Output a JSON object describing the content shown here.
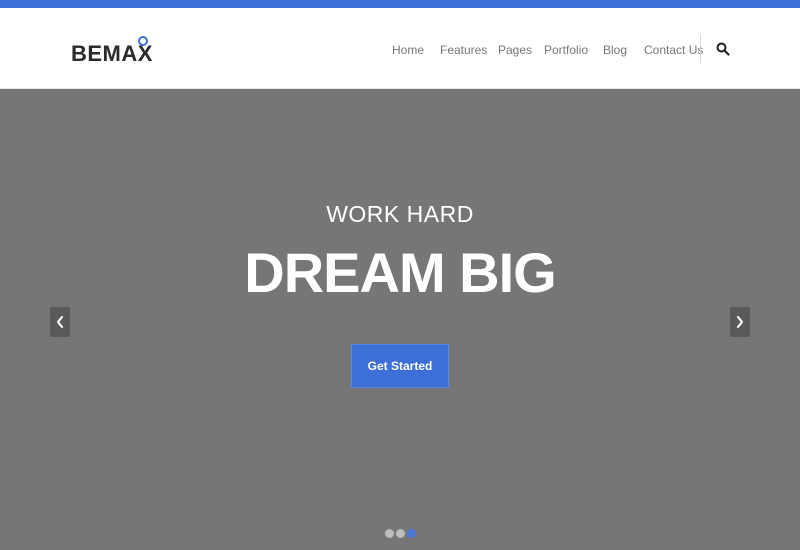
{
  "brand": {
    "name": "BEMAX",
    "accent_color": "#3e6fd6"
  },
  "nav": {
    "items": [
      {
        "label": "Home"
      },
      {
        "label": "Features"
      },
      {
        "label": "Pages"
      },
      {
        "label": "Portfolio"
      },
      {
        "label": "Blog"
      },
      {
        "label": "Contact Us"
      }
    ],
    "search_icon": "search-icon"
  },
  "hero": {
    "subtitle": "WORK HARD",
    "title": "DREAM BIG",
    "cta_label": "Get Started",
    "background_color": "#767676",
    "prev_icon": "chevron-left-icon",
    "next_icon": "chevron-right-icon",
    "slides_count": 3,
    "active_slide": 3
  }
}
